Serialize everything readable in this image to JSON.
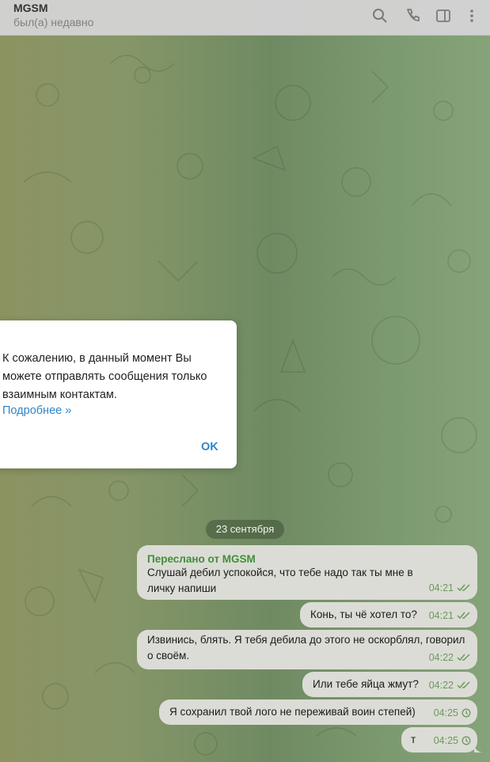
{
  "header": {
    "title": "MGSM",
    "status": "был(а) недавно",
    "icons": [
      "search-icon",
      "phone-icon",
      "sidebar-toggle-icon",
      "more-vert-icon"
    ]
  },
  "dialog": {
    "text": "К сожалению, в данный момент Вы можете отправлять сообщения только взаимным контактам.",
    "link": "Подробнее »",
    "ok_label": "OK"
  },
  "date_separator": "23 сентября",
  "messages": [
    {
      "forwarded_label": "Переслано от MGSM",
      "text": "Слушай дебил успокойся, что тебе надо так ты мне в личку напиши",
      "time": "04:21",
      "status": "read"
    },
    {
      "text": "Конь, ты чё хотел то?",
      "time": "04:21",
      "status": "read"
    },
    {
      "text": "Извинись, блять. Я тебя дебила до этого не оскорблял, говорил о своём.",
      "time": "04:22",
      "status": "read"
    },
    {
      "text": "Или тебе яйца жмут?",
      "time": "04:22",
      "status": "read"
    },
    {
      "text": "Я сохранил твой лого не переживай  воин степей)",
      "time": "04:25",
      "status": "pending"
    },
    {
      "text": "т",
      "time": "04:25",
      "status": "pending"
    }
  ],
  "colors": {
    "header_bg": "#d3d3d3",
    "bubble_bg": "#dcdcd6",
    "accent_link": "#2e86c9",
    "forward_name": "#3f8f3a",
    "check_marks": "#6a9a5c"
  }
}
